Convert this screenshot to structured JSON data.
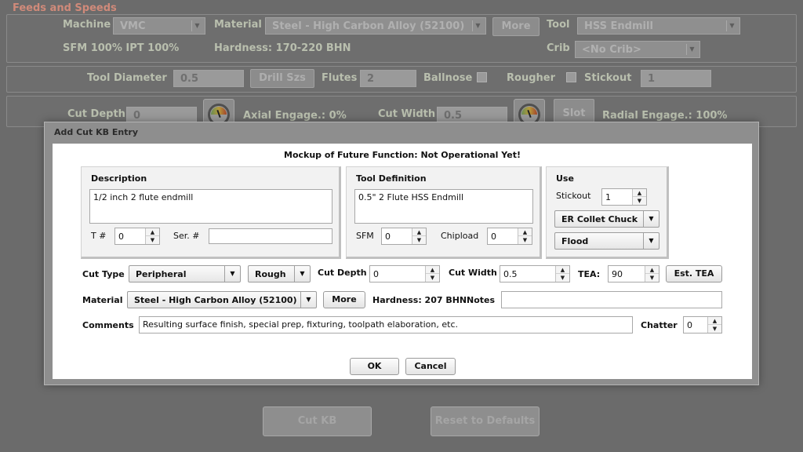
{
  "app": {
    "title": "Feeds and Speeds"
  },
  "background": {
    "machine_label": "Machine",
    "machine_value": "VMC",
    "material_label": "Material",
    "material_value": "Steel - High Carbon Alloy (52100)",
    "more_label": "More",
    "tool_label": "Tool",
    "tool_value": "HSS Endmill",
    "sfm_ipt": "SFM 100%   IPT 100%",
    "hardness": "Hardness: 170-220 BHN",
    "crib_label": "Crib",
    "crib_value": "<No Crib>",
    "tool_diameter_label": "Tool Diameter",
    "tool_diameter_value": "0.5",
    "drill_szs_label": "Drill Szs",
    "flutes_label": "Flutes",
    "flutes_value": "2",
    "ballnose_label": "Ballnose",
    "rougher_label": "Rougher",
    "stickout_label": "Stickout",
    "stickout_value": "1",
    "cut_depth_label": "Cut Depth",
    "cut_depth_value": "0",
    "axial_engage": "Axial Engage.: 0%",
    "cut_width_label": "Cut Width",
    "cut_width_value": "0.5",
    "slot_label": "Slot",
    "radial_engage": "Radial Engage.: 100%",
    "cut_kb_label": "Cut KB",
    "reset_label": "Reset to Defaults"
  },
  "dialog": {
    "title": "Add Cut KB Entry",
    "notice": "Mockup of Future Function: Not Operational Yet!",
    "description": {
      "header": "Description",
      "text": "1/2 inch 2 flute endmill",
      "t_label": "T #",
      "t_value": "0",
      "ser_label": "Ser. #",
      "ser_value": ""
    },
    "tool_definition": {
      "header": "Tool Definition",
      "text": "0.5\" 2 Flute HSS Endmill",
      "sfm_label": "SFM",
      "sfm_value": "0",
      "chipload_label": "Chipload",
      "chipload_value": "0"
    },
    "use": {
      "header": "Use",
      "stickout_label": "Stickout",
      "stickout_value": "1",
      "holder_value": "ER Collet Chuck",
      "coolant_value": "Flood"
    },
    "cut_type_label": "Cut Type",
    "cut_type_value": "Peripheral",
    "cut_mode_value": "Rough",
    "cut_depth_label": "Cut Depth",
    "cut_depth_value": "0",
    "cut_width_label": "Cut Width",
    "cut_width_value": "0.5",
    "tea_label": "TEA:",
    "tea_value": "90",
    "est_tea_label": "Est. TEA",
    "material_label": "Material",
    "material_value": "Steel - High Carbon Alloy (52100)",
    "more_label": "More",
    "hardness": "Hardness: 207 BHN",
    "notes_label": "Notes",
    "notes_value": "",
    "comments_label": "Comments",
    "comments_value": "Resulting surface finish, special prep, fixturing, toolpath elaboration, etc.",
    "chatter_label": "Chatter",
    "chatter_value": "0",
    "ok_label": "OK",
    "cancel_label": "Cancel"
  },
  "colors": {
    "dialog_frame": "#8e8e8e",
    "background": "#6b6b6b",
    "title_accent": "#d08a7a"
  }
}
